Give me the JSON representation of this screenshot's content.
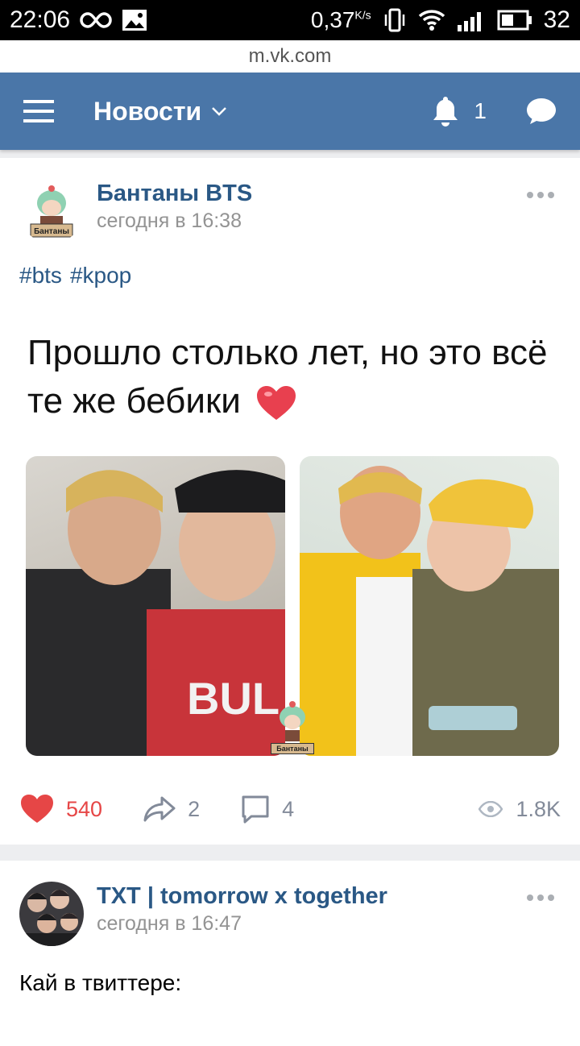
{
  "statusbar": {
    "time": "22:06",
    "speed": "0,37",
    "speed_unit": "K/s",
    "battery": "32"
  },
  "urlbar": {
    "url": "m.vk.com"
  },
  "header": {
    "title": "Новости",
    "notifications_count": "1"
  },
  "posts": [
    {
      "author": "Бантаны BTS",
      "date": "сегодня в 16:38",
      "avatar_label": "Бантаны",
      "tags": [
        "#bts",
        "#kpop"
      ],
      "meme_text": "Прошло столько лет, но это всё те же бебики",
      "watermark_label": "Бантаны",
      "likes": "540",
      "shares": "2",
      "comments": "4",
      "views": "1.8K"
    },
    {
      "author": "TXT | tomorrow x together",
      "date": "сегодня в 16:47",
      "text": "Кай в твиттере:"
    }
  ],
  "colors": {
    "header": "#4a76a8",
    "link": "#2a5885",
    "like": "#e64646",
    "muted": "#828a99"
  }
}
